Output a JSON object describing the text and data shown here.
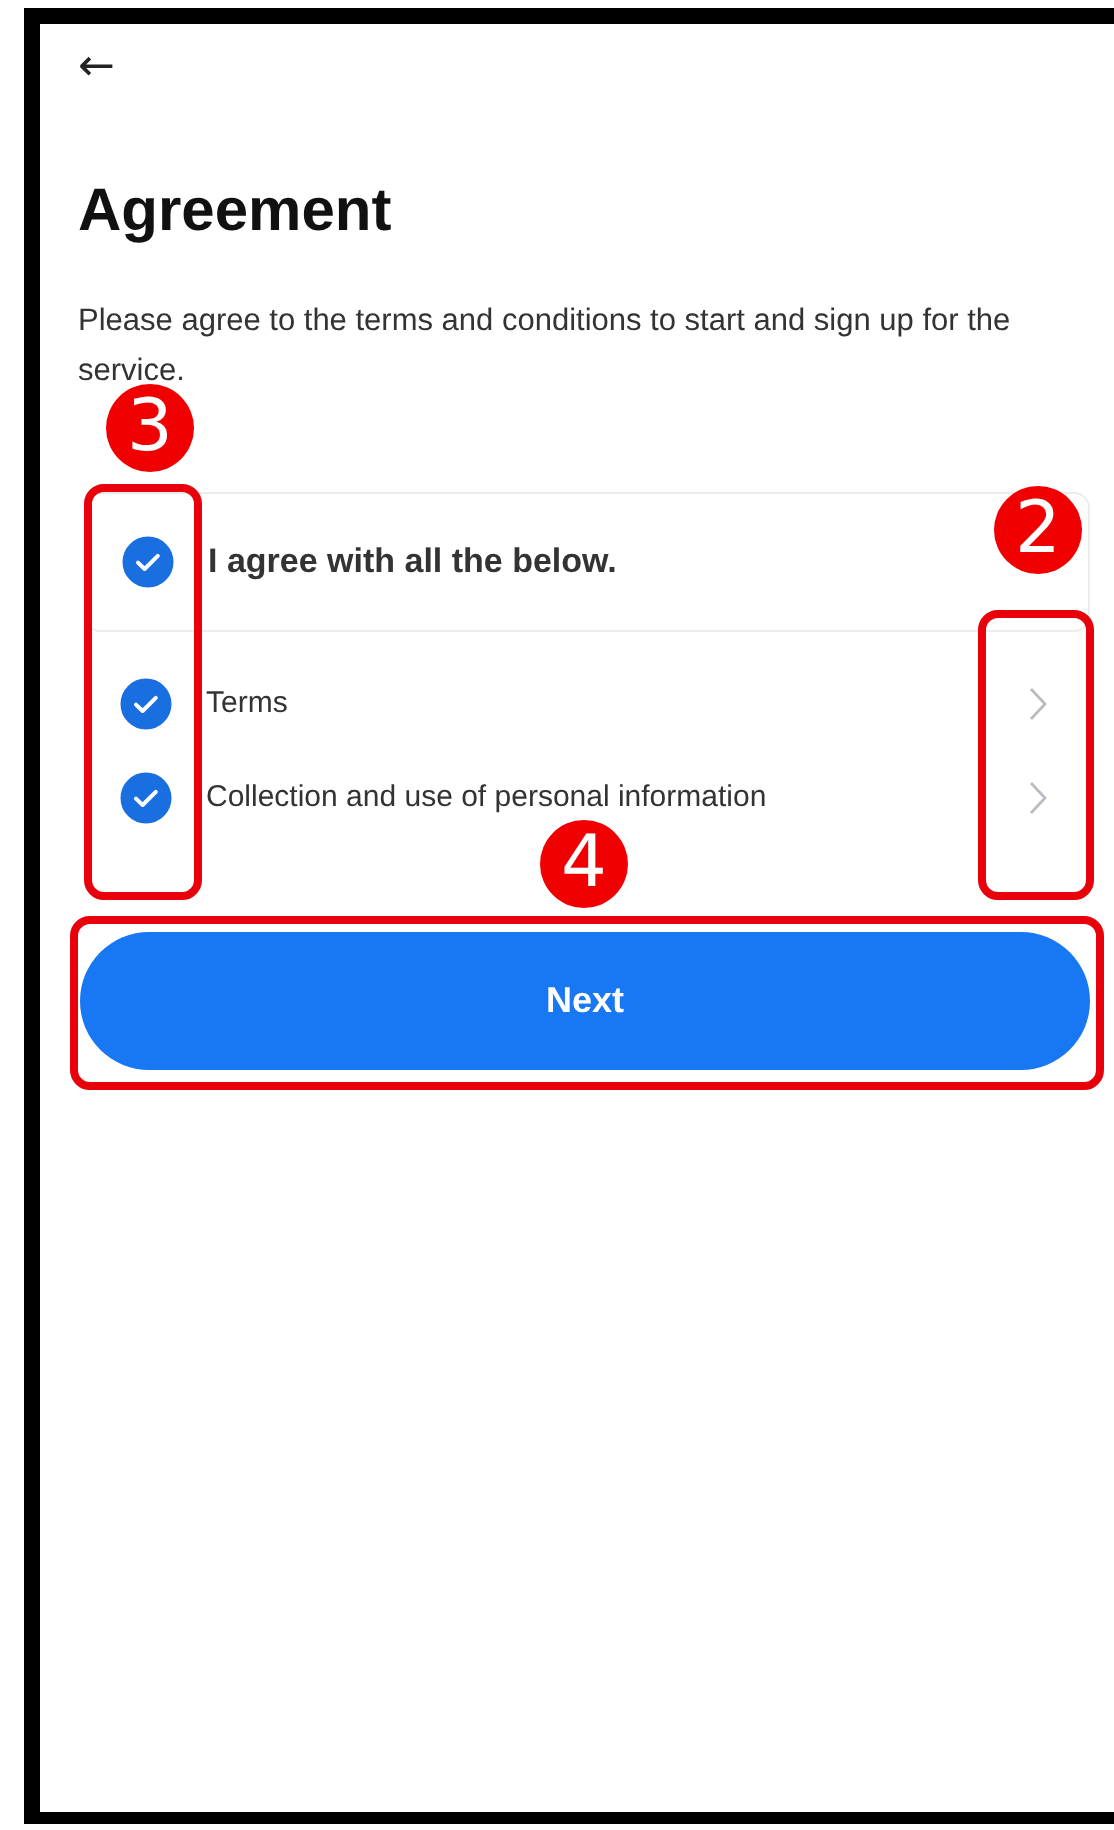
{
  "back_button": {
    "icon": "←"
  },
  "title": "Agreement",
  "description": "Please agree to the terms and conditions to start and sign up for the service.",
  "agree_all": {
    "label": "I agree with all the below.",
    "checked": true
  },
  "terms": [
    {
      "label": "Terms",
      "checked": true
    },
    {
      "label": "Collection and use of personal information",
      "checked": true
    }
  ],
  "next_button": {
    "label": "Next"
  },
  "annotations": [
    {
      "number": "3",
      "kind": "checkboxes"
    },
    {
      "number": "2",
      "kind": "chevrons"
    },
    {
      "number": "4",
      "kind": "next"
    }
  ]
}
